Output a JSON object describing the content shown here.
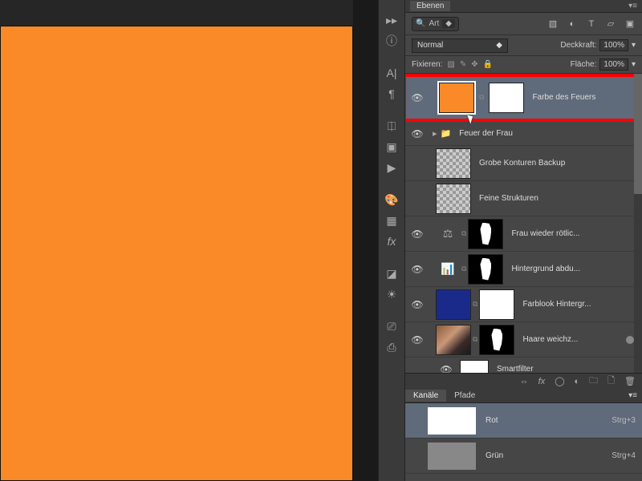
{
  "canvas": {
    "color": "#fa8a28"
  },
  "panel": {
    "title": "Ebenen",
    "search_label": "Art",
    "blend_mode": "Normal",
    "opacity_label": "Deckkraft:",
    "opacity_value": "100%",
    "lock_label": "Fixieren:",
    "fill_label": "Fläche:",
    "fill_value": "100%"
  },
  "layers": [
    {
      "name": "Farbe des Feuers",
      "visible": true,
      "selected": true,
      "kind": "fill-mask",
      "thumb": "orange",
      "mask": "white"
    },
    {
      "name": "Feuer der Frau",
      "visible": true,
      "kind": "group"
    },
    {
      "name": "Grobe Konturen Backup",
      "visible": false,
      "kind": "checker"
    },
    {
      "name": "Feine Strukturen",
      "visible": false,
      "kind": "checker"
    },
    {
      "name": "Frau wieder rötlic...",
      "visible": true,
      "kind": "adj-mask",
      "adj": "balance"
    },
    {
      "name": "Hintergrund abdu...",
      "visible": true,
      "kind": "adj-mask",
      "adj": "levels"
    },
    {
      "name": "Farblook Hintergr...",
      "visible": true,
      "kind": "fill-mask",
      "thumb": "darkblue",
      "mask": "white"
    },
    {
      "name": "Haare weichz...",
      "visible": true,
      "kind": "photo-mask",
      "smart": true
    },
    {
      "name": "Smartfilter",
      "visible": true,
      "kind": "smartfilter"
    }
  ],
  "channels": {
    "tab1": "Kanäle",
    "tab2": "Pfade",
    "rows": [
      {
        "name": "Rot",
        "shortcut": "Strg+3",
        "selected": true,
        "fill": "white"
      },
      {
        "name": "Grün",
        "shortcut": "Strg+4",
        "selected": false,
        "fill": "gray"
      }
    ]
  }
}
